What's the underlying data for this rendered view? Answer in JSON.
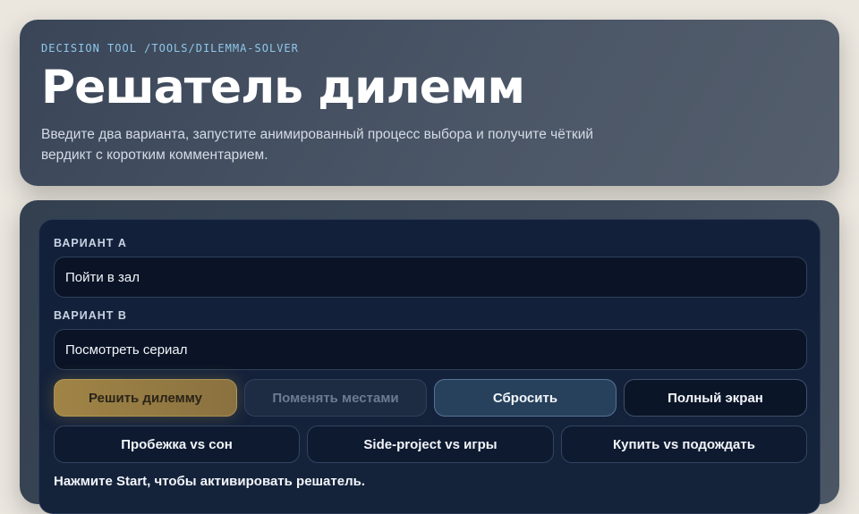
{
  "header": {
    "breadcrumb": "DECISION TOOL /TOOLS/DILEMMA-SOLVER",
    "title": "Решатель дилемм",
    "subtitle": "Введите два варианта, запустите анимированный процесс выбора и получите чёткий вердикт с коротким комментарием."
  },
  "form": {
    "option_a": {
      "label": "ВАРИАНТ A",
      "value": "Пойти в зал"
    },
    "option_b": {
      "label": "ВАРИАНТ B",
      "value": "Посмотреть сериал"
    }
  },
  "actions": {
    "solve": "Решить дилемму",
    "swap": "Поменять местами",
    "reset": "Сбросить",
    "fullscreen": "Полный экран"
  },
  "presets": [
    "Пробежка vs сон",
    "Side-project vs игры",
    "Купить vs подождать"
  ],
  "status": "Нажмите Start, чтобы активировать решатель.",
  "colors": {
    "accent": "#a08446",
    "background": "#ebe7df",
    "panel": "#13203a",
    "breadcrumb": "#8fc7ec"
  }
}
